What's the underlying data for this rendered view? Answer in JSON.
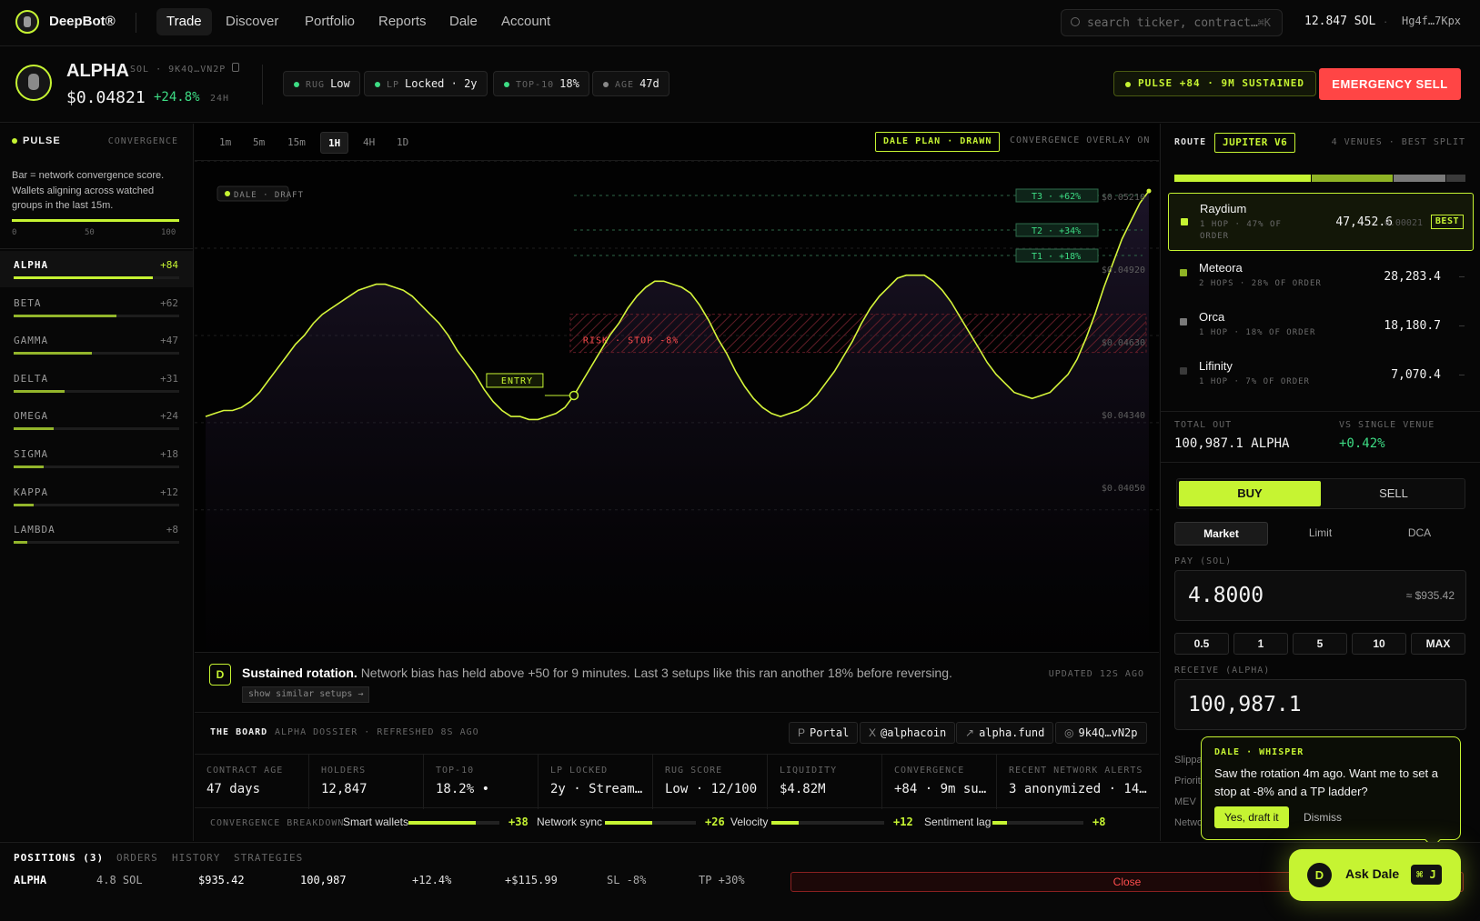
{
  "app": {
    "brand": "DeepBot®",
    "balance": "12.847 SOL",
    "wallet": "Hg4f…7Kpx",
    "separator": "·"
  },
  "nav": [
    "Trade",
    "Discover",
    "Portfolio",
    "Reports",
    "Dale",
    "Account"
  ],
  "search": {
    "placeholder": "search ticker, contract…",
    "shortcut": "⌘K"
  },
  "token": {
    "symbol": "ALPHA",
    "chain": "SOL · 9K4Q…VN2P",
    "price": "$0.04821",
    "change": "+24.8%",
    "period": "24H",
    "pills": [
      {
        "k": "RUG",
        "v": "Low"
      },
      {
        "k": "LP",
        "v": "Locked · 2y"
      },
      {
        "k": "TOP-10",
        "v": "18%"
      },
      {
        "k": "AGE",
        "v": "47d"
      }
    ],
    "pulse_badge": "PULSE +84 · 9M SUSTAINED",
    "emergency": "EMERGENCY SELL"
  },
  "pulse": {
    "title": "PULSE",
    "sub": "CONVERGENCE",
    "desc": "Bar = network convergence score. Wallets aligning across watched groups in the last 15m.",
    "ticks": [
      "0",
      "50",
      "100"
    ],
    "rows": [
      {
        "name": "ALPHA",
        "val": "+84",
        "score": 84,
        "selected": true
      },
      {
        "name": "BETA",
        "val": "+62",
        "score": 62
      },
      {
        "name": "GAMMA",
        "val": "+47",
        "score": 47
      },
      {
        "name": "DELTA",
        "val": "+31",
        "score": 31
      },
      {
        "name": "OMEGA",
        "val": "+24",
        "score": 24
      },
      {
        "name": "SIGMA",
        "val": "+18",
        "score": 18
      },
      {
        "name": "KAPPA",
        "val": "+12",
        "score": 12
      },
      {
        "name": "LAMBDA",
        "val": "+8",
        "score": 8
      }
    ]
  },
  "chart": {
    "timeframes": [
      "1m",
      "5m",
      "15m",
      "1H",
      "4H",
      "1D"
    ],
    "active_tf": "1H",
    "plan_badge": "DALE PLAN · DRAWN",
    "overlay": "CONVERGENCE OVERLAY ON",
    "draft": "DALE · DRAFT",
    "entry": "ENTRY",
    "risk": "RISK · STOP -8%",
    "targets": [
      "T3 · +62%",
      "T2 · +34%",
      "T1 · +18%"
    ],
    "price_labels": [
      "$0.05210",
      "$0.04920",
      "$0.04630",
      "$0.04340",
      "$0.04050"
    ]
  },
  "chart_data": {
    "type": "line",
    "title": "",
    "xlabel": "",
    "ylabel": "",
    "ylim": [
      0.0401,
      0.0528
    ],
    "values": [
      0.0443,
      0.0444,
      0.0445,
      0.0445,
      0.0446,
      0.0448,
      0.0451,
      0.0455,
      0.0459,
      0.0463,
      0.0467,
      0.047,
      0.0474,
      0.0477,
      0.0479,
      0.0481,
      0.0483,
      0.0485,
      0.0486,
      0.0487,
      0.0487,
      0.0486,
      0.0485,
      0.0483,
      0.048,
      0.0477,
      0.0474,
      0.047,
      0.0465,
      0.0461,
      0.0457,
      0.0452,
      0.0448,
      0.0445,
      0.0443,
      0.0443,
      0.0442,
      0.0442,
      0.0443,
      0.0444,
      0.0446,
      0.045,
      0.0455,
      0.046,
      0.0465,
      0.047,
      0.0474,
      0.0479,
      0.0483,
      0.0486,
      0.0488,
      0.0488,
      0.0487,
      0.0486,
      0.0484,
      0.048,
      0.0475,
      0.0469,
      0.0464,
      0.0458,
      0.0453,
      0.0449,
      0.0446,
      0.0444,
      0.0443,
      0.0444,
      0.0445,
      0.0447,
      0.045,
      0.0454,
      0.0458,
      0.0463,
      0.0468,
      0.0474,
      0.0479,
      0.0483,
      0.0486,
      0.0489,
      0.049,
      0.049,
      0.049,
      0.0488,
      0.0485,
      0.0481,
      0.0476,
      0.0471,
      0.0466,
      0.0461,
      0.0457,
      0.0454,
      0.0451,
      0.045,
      0.0449,
      0.045,
      0.0451,
      0.0454,
      0.0457,
      0.0462,
      0.0469,
      0.0477,
      0.0486,
      0.0494,
      0.0502,
      0.0508,
      0.0514,
      0.0518
    ],
    "grid": true
  },
  "insight": {
    "title": "Sustained rotation.",
    "body": "Network bias has held above +50 for 9 minutes. Last 3 setups like this ran another 18% before reversing.",
    "link": "show similar setups →",
    "updated": "UPDATED 12S AGO",
    "badge": "D"
  },
  "board": {
    "title": "THE BOARD",
    "sub": "ALPHA DOSSIER · REFRESHED 8S AGO",
    "links": [
      {
        "p": "P",
        "t": "Portal"
      },
      {
        "p": "X",
        "t": "@alphacoin"
      },
      {
        "p": "↗",
        "t": "alpha.fund"
      },
      {
        "p": "◎",
        "t": "9k4Q…vN2p"
      }
    ],
    "cells": [
      {
        "k": "CONTRACT AGE",
        "v": "47 days"
      },
      {
        "k": "HOLDERS",
        "v": "12,847"
      },
      {
        "k": "TOP-10",
        "v": "18.2% •"
      },
      {
        "k": "LP LOCKED",
        "v": "2y · Stream…"
      },
      {
        "k": "RUG SCORE",
        "v": "Low · 12/100"
      },
      {
        "k": "LIQUIDITY",
        "v": "$4.82M"
      },
      {
        "k": "CONVERGENCE",
        "v": "+84 · 9m su…"
      },
      {
        "k": "RECENT NETWORK ALERTS",
        "v": "3 anonymized · 14…"
      }
    ],
    "breakdown_label": "CONVERGENCE BREAKDOWN",
    "breakdown": [
      {
        "name": "Smart wallets",
        "val": "+38",
        "pct": 0.74
      },
      {
        "name": "Network sync",
        "val": "+26",
        "pct": 0.52
      },
      {
        "name": "Velocity",
        "val": "+12",
        "pct": 0.24
      },
      {
        "name": "Sentiment lag",
        "val": "+8",
        "pct": 0.16
      }
    ]
  },
  "route": {
    "label": "ROUTE",
    "engine": "JUPITER V6",
    "meta": "4 VENUES · BEST SPLIT",
    "venues": [
      {
        "name": "Raydium",
        "sub": "1 HOP · 47% OF ORDER",
        "amount": "47,452.6",
        "price": "0.00021",
        "best": "BEST",
        "share": 0.47,
        "color": "#c6f432"
      },
      {
        "name": "Meteora",
        "sub": "2 HOPS · 28% OF ORDER",
        "amount": "28,283.4",
        "price": "—",
        "share": 0.28,
        "color": "#8fb325"
      },
      {
        "name": "Orca",
        "sub": "1 HOP · 18% OF ORDER",
        "amount": "18,180.7",
        "price": "—",
        "share": 0.18,
        "color": "#7a7a7a"
      },
      {
        "name": "Lifinity",
        "sub": "1 HOP · 7% OF ORDER",
        "amount": "7,070.4",
        "price": "—",
        "share": 0.07,
        "color": "#3a3a3a"
      }
    ],
    "total_label": "TOTAL OUT",
    "total": "100,987.1 ALPHA",
    "vs_label": "VS SINGLE VENUE",
    "vs": "+0.42%"
  },
  "order": {
    "buy": "BUY",
    "sell": "SELL",
    "types": [
      "Market",
      "Limit",
      "DCA"
    ],
    "pay_label": "PAY (SOL)",
    "pay": "4.8000",
    "pay_usd": "≈ $935.42",
    "quick": [
      "0.5",
      "1",
      "5",
      "10",
      "MAX"
    ],
    "recv_label": "RECEIVE (ALPHA)",
    "recv": "100,987.1",
    "settings": [
      "Slippage",
      "Priority",
      "MEV",
      "Network"
    ]
  },
  "whisper": {
    "title": "DALE · WHISPER",
    "text": "Saw the rotation 4m ago. Want me to set a stop at -8% and a TP ladder?",
    "yes": "Yes, draft it",
    "no": "Dismiss"
  },
  "positions": {
    "tabs": [
      "POSITIONS (3)",
      "ORDERS",
      "HISTORY",
      "STRATEGIES"
    ],
    "row": {
      "sym": "ALPHA",
      "size": "4.8 SOL",
      "value": "$935.42",
      "qty": "100,987",
      "pct": "+12.4%",
      "pnl": "+$115.99",
      "sl": "SL -8%",
      "tp": "TP +30%",
      "close": "Close"
    }
  },
  "askdale": {
    "badge": "D",
    "label": "Ask Dale",
    "key": "⌘ J"
  }
}
